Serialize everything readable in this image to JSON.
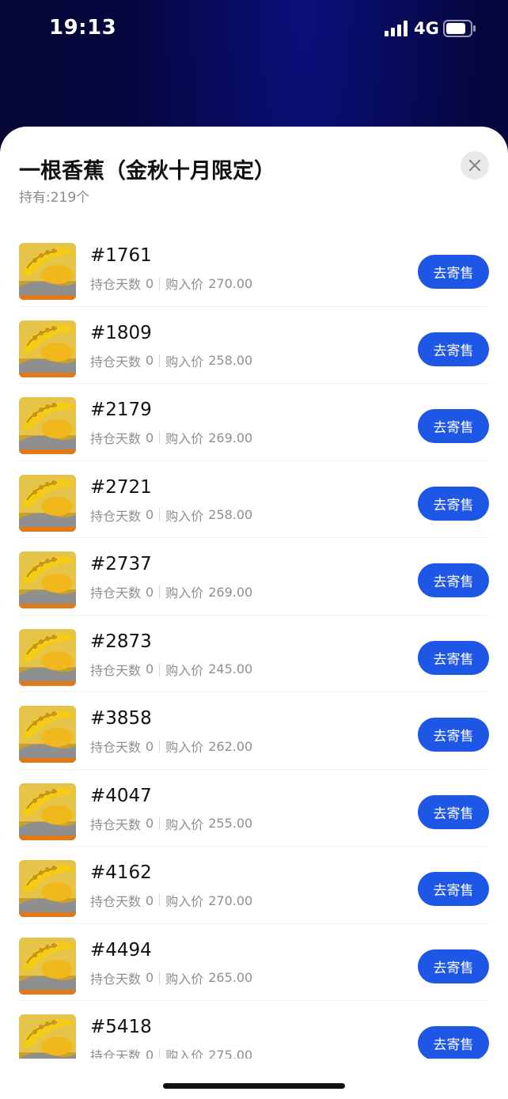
{
  "status_bar": {
    "time": "19:13",
    "network": "4G"
  },
  "sheet": {
    "title": "一根香蕉（金秋十月限定）",
    "subtitle": "持有:219个"
  },
  "labels": {
    "days_label": "持仓天数",
    "price_label": "购入价",
    "sell_button": "去寄售"
  },
  "items": [
    {
      "id": "#1761",
      "days": "0",
      "price": "270.00"
    },
    {
      "id": "#1809",
      "days": "0",
      "price": "258.00"
    },
    {
      "id": "#2179",
      "days": "0",
      "price": "269.00"
    },
    {
      "id": "#2721",
      "days": "0",
      "price": "258.00"
    },
    {
      "id": "#2737",
      "days": "0",
      "price": "269.00"
    },
    {
      "id": "#2873",
      "days": "0",
      "price": "245.00"
    },
    {
      "id": "#3858",
      "days": "0",
      "price": "262.00"
    },
    {
      "id": "#4047",
      "days": "0",
      "price": "255.00"
    },
    {
      "id": "#4162",
      "days": "0",
      "price": "270.00"
    },
    {
      "id": "#4494",
      "days": "0",
      "price": "265.00"
    },
    {
      "id": "#5418",
      "days": "0",
      "price": "275.00"
    }
  ],
  "colors": {
    "accent": "#1e56e6",
    "background_top": "#050740"
  }
}
